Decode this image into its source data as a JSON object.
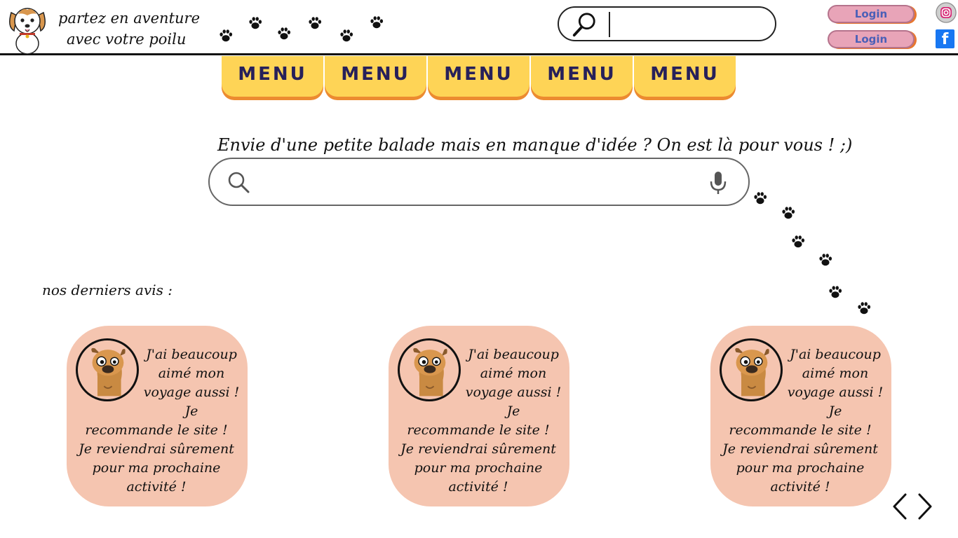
{
  "header": {
    "tagline_line1": "partez en aventure",
    "tagline_line2": "avec votre poilu",
    "search_placeholder": "",
    "login_buttons": [
      "Login",
      "Login"
    ],
    "social": {
      "facebook_glyph": "f"
    }
  },
  "menu": {
    "items": [
      "MENU",
      "MENU",
      "MENU",
      "MENU",
      "MENU"
    ]
  },
  "hero": {
    "prompt": "Envie d'une petite balade mais en manque d'idée ? On est là pour vous ! ;)",
    "search_placeholder": ""
  },
  "reviews": {
    "heading": "nos derniers avis :",
    "cards": [
      {
        "text": "J'ai beaucoup aimé mon voyage aussi ! Je recommande le site !\nJe reviendrai sûrement pour ma prochaine activité !"
      },
      {
        "text": "J'ai beaucoup aimé mon voyage aussi ! Je recommande le site !\nJe reviendrai sûrement pour ma prochaine activité !"
      },
      {
        "text": "J'ai beaucoup aimé mon voyage aussi ! Je recommande le site !\nJe reviendrai sûrement pour ma prochaine activité !"
      }
    ]
  },
  "icons": {
    "logo": "dog-logo-icon",
    "header_search": "magnifier-icon",
    "main_search": "search-icon",
    "mic": "microphone-icon",
    "instagram": "instagram-icon",
    "facebook": "facebook-icon",
    "paw": "paw-print-icon",
    "prev": "chevron-left-icon",
    "next": "chevron-right-icon"
  },
  "colors": {
    "menu_yellow": "#fed456",
    "menu_shadow": "#ec8b30",
    "menu_text": "#27205a",
    "card_pink": "#f5c5b0",
    "login_pink": "#e8a4b8",
    "login_text": "#4a5fb7",
    "facebook_blue": "#1877f2"
  }
}
